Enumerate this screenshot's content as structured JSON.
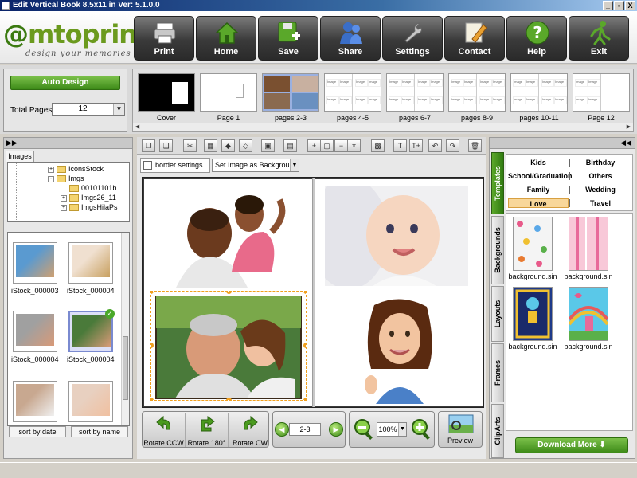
{
  "window": {
    "title": "Edit Vertical Book 8.5x11 in     Ver: 5.1.0.0",
    "min": "_",
    "max": "▫",
    "close": "X"
  },
  "logo": {
    "brand_at": "@",
    "brand": "mtoprint",
    "tagline": "design your memories"
  },
  "nav": [
    {
      "label": "Print",
      "icon": "printer-icon",
      "color": "#d0d0d0"
    },
    {
      "label": "Home",
      "icon": "home-icon",
      "color": "#5aa82a"
    },
    {
      "label": "Save",
      "icon": "save-icon",
      "color": "#5aa82a"
    },
    {
      "label": "Share",
      "icon": "share-icon",
      "color": "#3a6ec8"
    },
    {
      "label": "Settings",
      "icon": "wrench-icon",
      "color": "#c8c8c8"
    },
    {
      "label": "Contact",
      "icon": "pencil-icon",
      "color": "#e8e0c0"
    },
    {
      "label": "Help",
      "icon": "help-icon",
      "color": "#5aa82a"
    },
    {
      "label": "Exit",
      "icon": "exit-icon",
      "color": "#5aa82a"
    }
  ],
  "design": {
    "auto_design": "Auto Design",
    "total_pages_label": "Total Pages:",
    "total_pages_value": "12"
  },
  "page_thumbs": [
    {
      "label": "Cover"
    },
    {
      "label": "Page 1"
    },
    {
      "label": "pages 2-3"
    },
    {
      "label": "pages 4-5"
    },
    {
      "label": "pages 6-7"
    },
    {
      "label": "pages 8-9"
    },
    {
      "label": "pages 10-11"
    },
    {
      "label": "Page 12"
    }
  ],
  "thumb_cell_text": "Image",
  "left_panel": {
    "collapse": "▶▶",
    "tab": "Images",
    "tree": [
      {
        "label": "IconsStock",
        "expander": "+"
      },
      {
        "label": "Imgs",
        "expander": "-"
      },
      {
        "label": "00101101b",
        "expander": ""
      },
      {
        "label": "Imgs26_11",
        "expander": "+"
      },
      {
        "label": "ImgsHilaPs",
        "expander": "+"
      }
    ],
    "images": [
      {
        "label": "iStock_000003"
      },
      {
        "label": "iStock_000004"
      },
      {
        "label": "iStock_000004"
      },
      {
        "label": "iStock_000004"
      },
      {
        "label": "",
        "selected": false
      },
      {
        "label": ""
      }
    ],
    "sort_by_date": "sort by date",
    "sort_by_name": "sort by name"
  },
  "editor": {
    "border_settings": "border settings",
    "set_image_as_background": "Set Image as Backgrou",
    "page_number": "2-3",
    "zoom": "100%",
    "rotate_ccw": "Rotate CCW",
    "rotate_180": "Rotate 180°",
    "rotate_cw": "Rotate CW",
    "preview": "Preview"
  },
  "right_panel": {
    "collapse": "◀◀",
    "tabs": [
      "Templates",
      "Backgrounds",
      "Layouts",
      "Frames",
      "ClipArts"
    ],
    "categories": [
      [
        "Kids",
        "Birthday"
      ],
      [
        "School/Graduation",
        "Others"
      ],
      [
        "Family",
        "Wedding"
      ],
      [
        "Love",
        "Travel"
      ]
    ],
    "selected_category": "Love",
    "backgrounds": [
      {
        "label": "background.sin",
        "color": "#f4f4f4"
      },
      {
        "label": "background.sin",
        "color": "#f8c8d8"
      },
      {
        "label": "background.sin",
        "color": "#1e3a8a"
      },
      {
        "label": "background.sin",
        "color": "#5ac8e8"
      }
    ],
    "download_more": "Download More"
  }
}
